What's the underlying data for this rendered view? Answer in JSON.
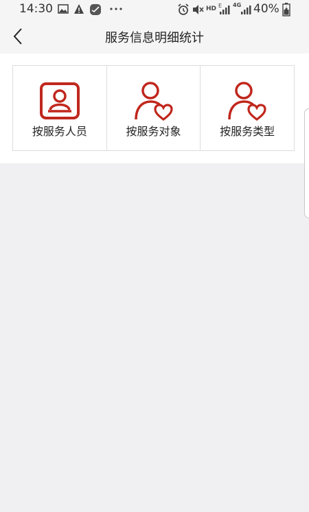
{
  "status_bar": {
    "time": "14:30",
    "network_hd": "HD",
    "network_e": "E",
    "network_4g": "4G",
    "battery_text": "40%",
    "icons": [
      "image-icon",
      "alert-icon",
      "app-check-icon",
      "more-dots-icon",
      "alarm-icon",
      "mute-icon",
      "signal-icon",
      "battery-icon"
    ]
  },
  "header": {
    "title": "服务信息明细统计"
  },
  "menu": {
    "items": [
      {
        "label": "按服务人员",
        "icon": "contact-card-icon"
      },
      {
        "label": "按服务对象",
        "icon": "person-heart-icon"
      },
      {
        "label": "按服务类型",
        "icon": "person-heart-icon"
      }
    ]
  },
  "colors": {
    "accent": "#c0271d",
    "background": "#f0f0f2",
    "card": "#ffffff",
    "border": "#dcdcdc"
  }
}
